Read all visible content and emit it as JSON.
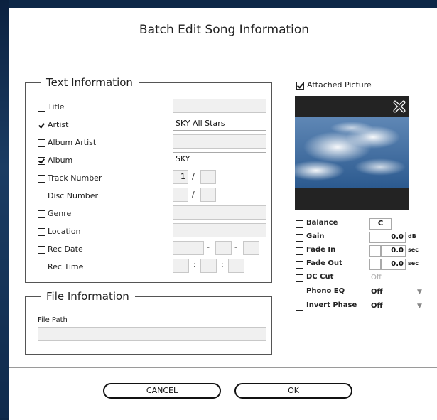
{
  "dialog": {
    "title": "Batch Edit Song Information",
    "text_group": "Text Information",
    "file_group": "File Information",
    "cancel": "CANCEL",
    "ok": "OK"
  },
  "text_fields": [
    {
      "label": "Title",
      "checked": false,
      "value": ""
    },
    {
      "label": "Artist",
      "checked": true,
      "value": "SKY All Stars"
    },
    {
      "label": "Album Artist",
      "checked": false,
      "value": ""
    },
    {
      "label": "Album",
      "checked": true,
      "value": "SKY"
    },
    {
      "label": "Track Number",
      "checked": false,
      "value": "1",
      "sep": "/"
    },
    {
      "label": "Disc Number",
      "checked": false,
      "value": "",
      "sep": "/"
    },
    {
      "label": "Genre",
      "checked": false,
      "value": ""
    },
    {
      "label": "Location",
      "checked": false,
      "value": ""
    },
    {
      "label": "Rec Date",
      "checked": false,
      "sep": "-"
    },
    {
      "label": "Rec Time",
      "checked": false,
      "sep": ":"
    }
  ],
  "file": {
    "path_label": "File Path",
    "path_value": ""
  },
  "picture": {
    "label": "Attached Picture",
    "checked": true,
    "remove_icon": "close-x-icon"
  },
  "audio": {
    "balance": {
      "label": "Balance",
      "value": "C"
    },
    "gain": {
      "label": "Gain",
      "value": "0.0",
      "unit": "dB"
    },
    "fade_in": {
      "label": "Fade In",
      "value": "0.0",
      "unit": "sec"
    },
    "fade_out": {
      "label": "Fade Out",
      "value": "0.0",
      "unit": "sec"
    },
    "dc_cut": {
      "label": "DC Cut",
      "value": "Off"
    },
    "phono_eq": {
      "label": "Phono EQ",
      "value": "Off"
    },
    "invert_phase": {
      "label": "Invert Phase",
      "value": "Off"
    }
  },
  "colors": {
    "accent_background": "#0d2747",
    "dialog": "#ffffff"
  }
}
